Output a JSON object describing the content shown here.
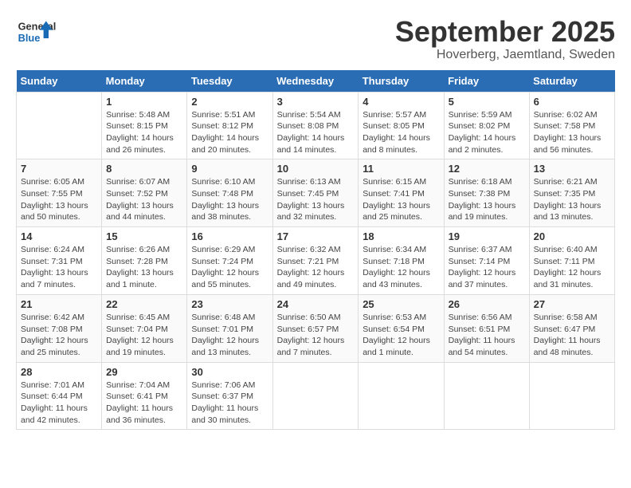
{
  "header": {
    "logo_general": "General",
    "logo_blue": "Blue",
    "title": "September 2025",
    "subtitle": "Hoverberg, Jaemtland, Sweden"
  },
  "calendar": {
    "days_of_week": [
      "Sunday",
      "Monday",
      "Tuesday",
      "Wednesday",
      "Thursday",
      "Friday",
      "Saturday"
    ],
    "weeks": [
      [
        {
          "day": "",
          "detail": ""
        },
        {
          "day": "1",
          "detail": "Sunrise: 5:48 AM\nSunset: 8:15 PM\nDaylight: 14 hours\nand 26 minutes."
        },
        {
          "day": "2",
          "detail": "Sunrise: 5:51 AM\nSunset: 8:12 PM\nDaylight: 14 hours\nand 20 minutes."
        },
        {
          "day": "3",
          "detail": "Sunrise: 5:54 AM\nSunset: 8:08 PM\nDaylight: 14 hours\nand 14 minutes."
        },
        {
          "day": "4",
          "detail": "Sunrise: 5:57 AM\nSunset: 8:05 PM\nDaylight: 14 hours\nand 8 minutes."
        },
        {
          "day": "5",
          "detail": "Sunrise: 5:59 AM\nSunset: 8:02 PM\nDaylight: 14 hours\nand 2 minutes."
        },
        {
          "day": "6",
          "detail": "Sunrise: 6:02 AM\nSunset: 7:58 PM\nDaylight: 13 hours\nand 56 minutes."
        }
      ],
      [
        {
          "day": "7",
          "detail": "Sunrise: 6:05 AM\nSunset: 7:55 PM\nDaylight: 13 hours\nand 50 minutes."
        },
        {
          "day": "8",
          "detail": "Sunrise: 6:07 AM\nSunset: 7:52 PM\nDaylight: 13 hours\nand 44 minutes."
        },
        {
          "day": "9",
          "detail": "Sunrise: 6:10 AM\nSunset: 7:48 PM\nDaylight: 13 hours\nand 38 minutes."
        },
        {
          "day": "10",
          "detail": "Sunrise: 6:13 AM\nSunset: 7:45 PM\nDaylight: 13 hours\nand 32 minutes."
        },
        {
          "day": "11",
          "detail": "Sunrise: 6:15 AM\nSunset: 7:41 PM\nDaylight: 13 hours\nand 25 minutes."
        },
        {
          "day": "12",
          "detail": "Sunrise: 6:18 AM\nSunset: 7:38 PM\nDaylight: 13 hours\nand 19 minutes."
        },
        {
          "day": "13",
          "detail": "Sunrise: 6:21 AM\nSunset: 7:35 PM\nDaylight: 13 hours\nand 13 minutes."
        }
      ],
      [
        {
          "day": "14",
          "detail": "Sunrise: 6:24 AM\nSunset: 7:31 PM\nDaylight: 13 hours\nand 7 minutes."
        },
        {
          "day": "15",
          "detail": "Sunrise: 6:26 AM\nSunset: 7:28 PM\nDaylight: 13 hours\nand 1 minute."
        },
        {
          "day": "16",
          "detail": "Sunrise: 6:29 AM\nSunset: 7:24 PM\nDaylight: 12 hours\nand 55 minutes."
        },
        {
          "day": "17",
          "detail": "Sunrise: 6:32 AM\nSunset: 7:21 PM\nDaylight: 12 hours\nand 49 minutes."
        },
        {
          "day": "18",
          "detail": "Sunrise: 6:34 AM\nSunset: 7:18 PM\nDaylight: 12 hours\nand 43 minutes."
        },
        {
          "day": "19",
          "detail": "Sunrise: 6:37 AM\nSunset: 7:14 PM\nDaylight: 12 hours\nand 37 minutes."
        },
        {
          "day": "20",
          "detail": "Sunrise: 6:40 AM\nSunset: 7:11 PM\nDaylight: 12 hours\nand 31 minutes."
        }
      ],
      [
        {
          "day": "21",
          "detail": "Sunrise: 6:42 AM\nSunset: 7:08 PM\nDaylight: 12 hours\nand 25 minutes."
        },
        {
          "day": "22",
          "detail": "Sunrise: 6:45 AM\nSunset: 7:04 PM\nDaylight: 12 hours\nand 19 minutes."
        },
        {
          "day": "23",
          "detail": "Sunrise: 6:48 AM\nSunset: 7:01 PM\nDaylight: 12 hours\nand 13 minutes."
        },
        {
          "day": "24",
          "detail": "Sunrise: 6:50 AM\nSunset: 6:57 PM\nDaylight: 12 hours\nand 7 minutes."
        },
        {
          "day": "25",
          "detail": "Sunrise: 6:53 AM\nSunset: 6:54 PM\nDaylight: 12 hours\nand 1 minute."
        },
        {
          "day": "26",
          "detail": "Sunrise: 6:56 AM\nSunset: 6:51 PM\nDaylight: 11 hours\nand 54 minutes."
        },
        {
          "day": "27",
          "detail": "Sunrise: 6:58 AM\nSunset: 6:47 PM\nDaylight: 11 hours\nand 48 minutes."
        }
      ],
      [
        {
          "day": "28",
          "detail": "Sunrise: 7:01 AM\nSunset: 6:44 PM\nDaylight: 11 hours\nand 42 minutes."
        },
        {
          "day": "29",
          "detail": "Sunrise: 7:04 AM\nSunset: 6:41 PM\nDaylight: 11 hours\nand 36 minutes."
        },
        {
          "day": "30",
          "detail": "Sunrise: 7:06 AM\nSunset: 6:37 PM\nDaylight: 11 hours\nand 30 minutes."
        },
        {
          "day": "",
          "detail": ""
        },
        {
          "day": "",
          "detail": ""
        },
        {
          "day": "",
          "detail": ""
        },
        {
          "day": "",
          "detail": ""
        }
      ]
    ]
  }
}
